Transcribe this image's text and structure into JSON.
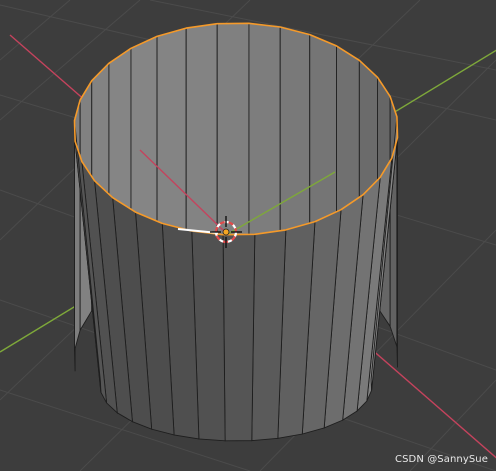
{
  "viewport": {
    "background_color": "#3d3d3d",
    "grid_color": "#4b4b4b",
    "x_axis_color": "#c4435d",
    "y_axis_color": "#7ea83a"
  },
  "mesh": {
    "object": "cylinder",
    "segments": 32,
    "fill_color": "#8c8c8c",
    "edge_color": "#1e1e1e",
    "selected_rim_color": "#f59a2a"
  },
  "gizmo": {
    "icon": "3d-cursor-icon",
    "ring_color_a": "#e24b4b",
    "ring_color_b": "#ffffff"
  },
  "watermark": {
    "text": "CSDN @SannySue"
  }
}
